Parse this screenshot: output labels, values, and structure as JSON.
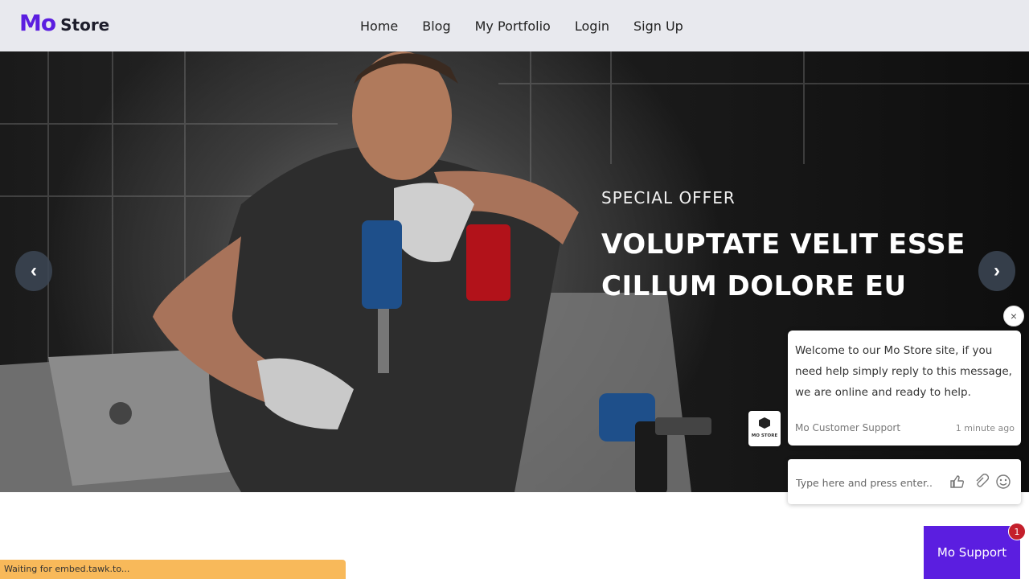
{
  "header": {
    "logo_mo": "Mo",
    "logo_store": "Store",
    "nav": [
      "Home",
      "Blog",
      "My Portfolio",
      "Login",
      "Sign Up"
    ]
  },
  "hero": {
    "eyebrow": "SPECIAL OFFER",
    "title_line1": "VOLUPTATE VELIT ESSE",
    "title_line2": "CILLUM DOLORE EU",
    "prev_symbol": "‹",
    "next_symbol": "›"
  },
  "chat": {
    "close_symbol": "×",
    "message": "Welcome to our Mo Store site, if you need help simply reply to this message, we are online and ready to help.",
    "agent": "Mo Customer Support",
    "time": "1 minute ago",
    "avatar_text": "MO STORE",
    "input_placeholder": "Type here and press enter..",
    "launcher_label": "Mo Support",
    "unread_count": "1",
    "icons": [
      "thumbs-up-icon",
      "paperclip-icon",
      "smiley-icon"
    ]
  },
  "status": {
    "text": "Waiting for embed.tawk.to..."
  },
  "colors": {
    "brand": "#5b1ee0",
    "header_bg": "#e8e9ee",
    "status_bar": "#f8b95a",
    "badge": "#c41f2b"
  }
}
